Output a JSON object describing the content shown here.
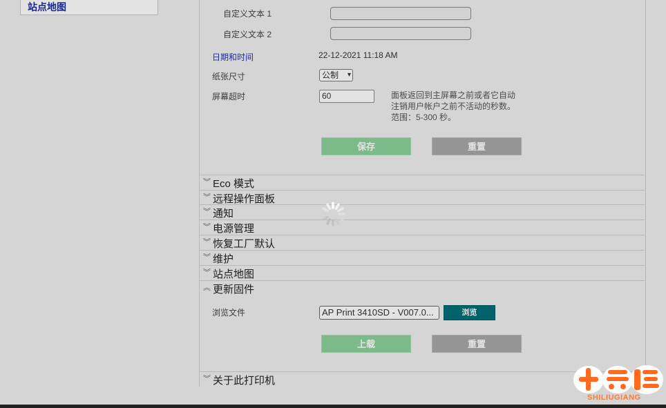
{
  "sidebar": {
    "item_label": "站点地图"
  },
  "settings": {
    "custom_text_1_label": "自定义文本 1",
    "custom_text_1_value": "",
    "custom_text_2_label": "自定义文本 2",
    "custom_text_2_value": "",
    "datetime_label": "日期和时间",
    "datetime_value": "22-12-2021 11:18 AM",
    "paper_size_label": "纸张尺寸",
    "paper_size_value": "公制",
    "screen_timeout_label": "屏幕超时",
    "screen_timeout_value": "60",
    "screen_timeout_help_1": "面板返回到主屏幕之前或者它自动",
    "screen_timeout_help_2": "注销用户帐户之前不活动的秒数。",
    "screen_timeout_help_3": "范围：5-300 秒。",
    "save_label": "保存",
    "reset_label": "重置"
  },
  "sections": [
    {
      "title": "Eco 模式",
      "expanded": false
    },
    {
      "title": "远程操作面板",
      "expanded": false
    },
    {
      "title": "通知",
      "expanded": false
    },
    {
      "title": "电源管理",
      "expanded": false
    },
    {
      "title": "恢复工厂默认",
      "expanded": false
    },
    {
      "title": "维护",
      "expanded": false
    },
    {
      "title": "站点地图",
      "expanded": false
    },
    {
      "title": "更新固件",
      "expanded": true
    },
    {
      "title": "关于此打印机",
      "expanded": false
    }
  ],
  "firmware": {
    "browse_label": "浏览文件",
    "file_value": "AP Print 3410SD - V007.0...",
    "browse_button": "浏览",
    "upload_label": "上载",
    "reset_label": "重置"
  },
  "watermark": {
    "text": "SHILIUGIANG"
  },
  "icons": {
    "collapsed": "chevron-double-down-icon",
    "expanded": "chevron-double-up-icon",
    "loading": "loading-spinner-icon"
  },
  "colors": {
    "link": "#2233aa",
    "save_green": "#8dd19c",
    "browse_teal": "#00707a",
    "watermark_orange": "#ff7a33"
  }
}
